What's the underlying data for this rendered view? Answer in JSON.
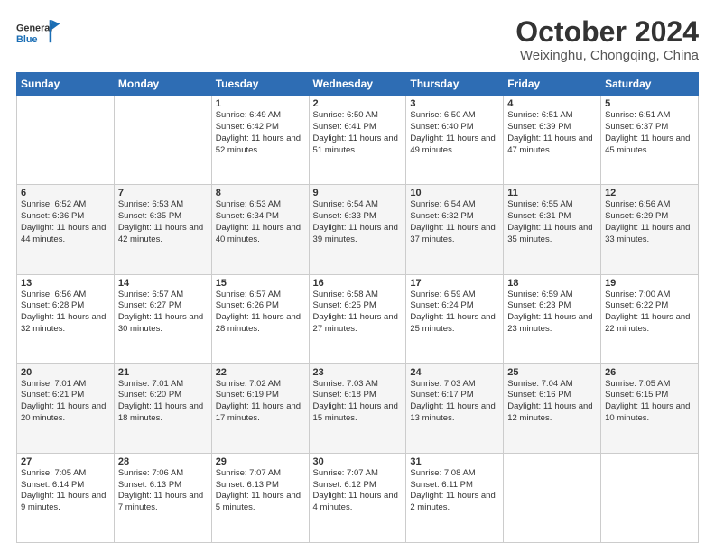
{
  "header": {
    "logo_text_general": "General",
    "logo_text_blue": "Blue",
    "title": "October 2024",
    "subtitle": "Weixinghu, Chongqing, China"
  },
  "calendar": {
    "headers": [
      "Sunday",
      "Monday",
      "Tuesday",
      "Wednesday",
      "Thursday",
      "Friday",
      "Saturday"
    ],
    "weeks": [
      [
        {
          "day": "",
          "sunrise": "",
          "sunset": "",
          "daylight": ""
        },
        {
          "day": "",
          "sunrise": "",
          "sunset": "",
          "daylight": ""
        },
        {
          "day": "1",
          "sunrise": "Sunrise: 6:49 AM",
          "sunset": "Sunset: 6:42 PM",
          "daylight": "Daylight: 11 hours and 52 minutes."
        },
        {
          "day": "2",
          "sunrise": "Sunrise: 6:50 AM",
          "sunset": "Sunset: 6:41 PM",
          "daylight": "Daylight: 11 hours and 51 minutes."
        },
        {
          "day": "3",
          "sunrise": "Sunrise: 6:50 AM",
          "sunset": "Sunset: 6:40 PM",
          "daylight": "Daylight: 11 hours and 49 minutes."
        },
        {
          "day": "4",
          "sunrise": "Sunrise: 6:51 AM",
          "sunset": "Sunset: 6:39 PM",
          "daylight": "Daylight: 11 hours and 47 minutes."
        },
        {
          "day": "5",
          "sunrise": "Sunrise: 6:51 AM",
          "sunset": "Sunset: 6:37 PM",
          "daylight": "Daylight: 11 hours and 45 minutes."
        }
      ],
      [
        {
          "day": "6",
          "sunrise": "Sunrise: 6:52 AM",
          "sunset": "Sunset: 6:36 PM",
          "daylight": "Daylight: 11 hours and 44 minutes."
        },
        {
          "day": "7",
          "sunrise": "Sunrise: 6:53 AM",
          "sunset": "Sunset: 6:35 PM",
          "daylight": "Daylight: 11 hours and 42 minutes."
        },
        {
          "day": "8",
          "sunrise": "Sunrise: 6:53 AM",
          "sunset": "Sunset: 6:34 PM",
          "daylight": "Daylight: 11 hours and 40 minutes."
        },
        {
          "day": "9",
          "sunrise": "Sunrise: 6:54 AM",
          "sunset": "Sunset: 6:33 PM",
          "daylight": "Daylight: 11 hours and 39 minutes."
        },
        {
          "day": "10",
          "sunrise": "Sunrise: 6:54 AM",
          "sunset": "Sunset: 6:32 PM",
          "daylight": "Daylight: 11 hours and 37 minutes."
        },
        {
          "day": "11",
          "sunrise": "Sunrise: 6:55 AM",
          "sunset": "Sunset: 6:31 PM",
          "daylight": "Daylight: 11 hours and 35 minutes."
        },
        {
          "day": "12",
          "sunrise": "Sunrise: 6:56 AM",
          "sunset": "Sunset: 6:29 PM",
          "daylight": "Daylight: 11 hours and 33 minutes."
        }
      ],
      [
        {
          "day": "13",
          "sunrise": "Sunrise: 6:56 AM",
          "sunset": "Sunset: 6:28 PM",
          "daylight": "Daylight: 11 hours and 32 minutes."
        },
        {
          "day": "14",
          "sunrise": "Sunrise: 6:57 AM",
          "sunset": "Sunset: 6:27 PM",
          "daylight": "Daylight: 11 hours and 30 minutes."
        },
        {
          "day": "15",
          "sunrise": "Sunrise: 6:57 AM",
          "sunset": "Sunset: 6:26 PM",
          "daylight": "Daylight: 11 hours and 28 minutes."
        },
        {
          "day": "16",
          "sunrise": "Sunrise: 6:58 AM",
          "sunset": "Sunset: 6:25 PM",
          "daylight": "Daylight: 11 hours and 27 minutes."
        },
        {
          "day": "17",
          "sunrise": "Sunrise: 6:59 AM",
          "sunset": "Sunset: 6:24 PM",
          "daylight": "Daylight: 11 hours and 25 minutes."
        },
        {
          "day": "18",
          "sunrise": "Sunrise: 6:59 AM",
          "sunset": "Sunset: 6:23 PM",
          "daylight": "Daylight: 11 hours and 23 minutes."
        },
        {
          "day": "19",
          "sunrise": "Sunrise: 7:00 AM",
          "sunset": "Sunset: 6:22 PM",
          "daylight": "Daylight: 11 hours and 22 minutes."
        }
      ],
      [
        {
          "day": "20",
          "sunrise": "Sunrise: 7:01 AM",
          "sunset": "Sunset: 6:21 PM",
          "daylight": "Daylight: 11 hours and 20 minutes."
        },
        {
          "day": "21",
          "sunrise": "Sunrise: 7:01 AM",
          "sunset": "Sunset: 6:20 PM",
          "daylight": "Daylight: 11 hours and 18 minutes."
        },
        {
          "day": "22",
          "sunrise": "Sunrise: 7:02 AM",
          "sunset": "Sunset: 6:19 PM",
          "daylight": "Daylight: 11 hours and 17 minutes."
        },
        {
          "day": "23",
          "sunrise": "Sunrise: 7:03 AM",
          "sunset": "Sunset: 6:18 PM",
          "daylight": "Daylight: 11 hours and 15 minutes."
        },
        {
          "day": "24",
          "sunrise": "Sunrise: 7:03 AM",
          "sunset": "Sunset: 6:17 PM",
          "daylight": "Daylight: 11 hours and 13 minutes."
        },
        {
          "day": "25",
          "sunrise": "Sunrise: 7:04 AM",
          "sunset": "Sunset: 6:16 PM",
          "daylight": "Daylight: 11 hours and 12 minutes."
        },
        {
          "day": "26",
          "sunrise": "Sunrise: 7:05 AM",
          "sunset": "Sunset: 6:15 PM",
          "daylight": "Daylight: 11 hours and 10 minutes."
        }
      ],
      [
        {
          "day": "27",
          "sunrise": "Sunrise: 7:05 AM",
          "sunset": "Sunset: 6:14 PM",
          "daylight": "Daylight: 11 hours and 9 minutes."
        },
        {
          "day": "28",
          "sunrise": "Sunrise: 7:06 AM",
          "sunset": "Sunset: 6:13 PM",
          "daylight": "Daylight: 11 hours and 7 minutes."
        },
        {
          "day": "29",
          "sunrise": "Sunrise: 7:07 AM",
          "sunset": "Sunset: 6:13 PM",
          "daylight": "Daylight: 11 hours and 5 minutes."
        },
        {
          "day": "30",
          "sunrise": "Sunrise: 7:07 AM",
          "sunset": "Sunset: 6:12 PM",
          "daylight": "Daylight: 11 hours and 4 minutes."
        },
        {
          "day": "31",
          "sunrise": "Sunrise: 7:08 AM",
          "sunset": "Sunset: 6:11 PM",
          "daylight": "Daylight: 11 hours and 2 minutes."
        },
        {
          "day": "",
          "sunrise": "",
          "sunset": "",
          "daylight": ""
        },
        {
          "day": "",
          "sunrise": "",
          "sunset": "",
          "daylight": ""
        }
      ]
    ]
  }
}
